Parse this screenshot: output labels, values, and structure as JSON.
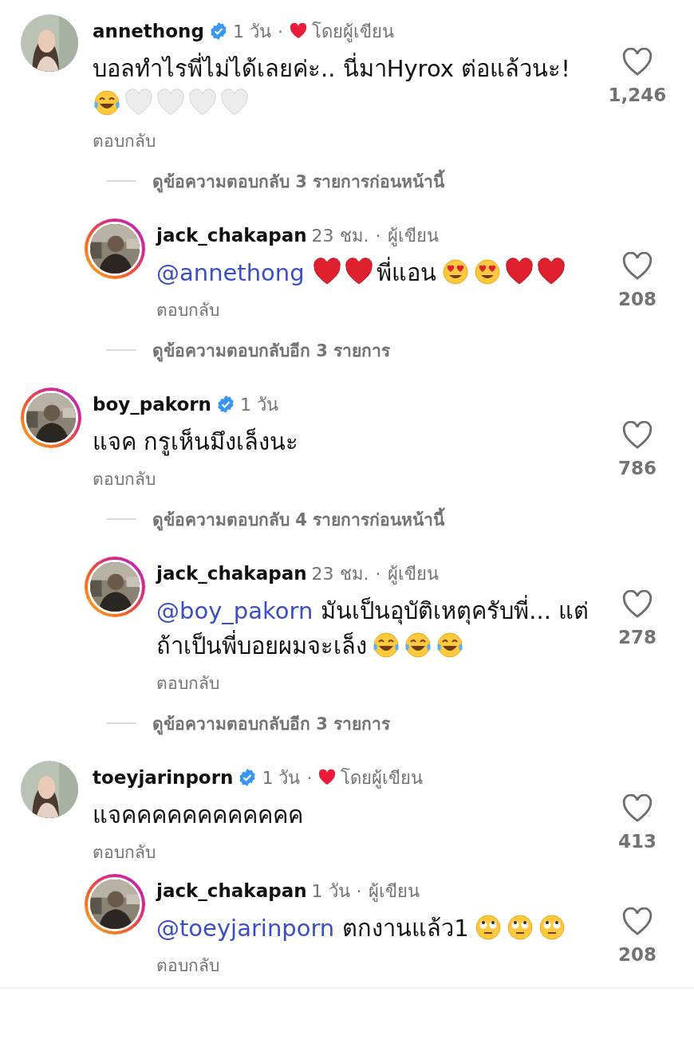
{
  "comments": [
    {
      "username": "annethong",
      "verified": true,
      "story_ring": false,
      "time": "1 วัน",
      "separator": "·",
      "liked_by_author": true,
      "author_note": "โดยผู้เขียน",
      "liked": false,
      "likes": "1,246",
      "reply_label": "ตอบกลับ",
      "view_replies": "ดูข้อความตอบกลับ 3 รายการก่อนหน้านี้",
      "text": [
        {
          "kind": "text",
          "text": "บอลทำไรพี่ไม่ได้เลยค่ะ.. นี่มาHyrox ต่อแล้วนะ!"
        },
        {
          "kind": "break"
        },
        {
          "kind": "joy"
        },
        {
          "kind": "white_heart"
        },
        {
          "kind": "white_heart"
        },
        {
          "kind": "white_heart"
        },
        {
          "kind": "white_heart"
        }
      ],
      "replies": [
        {
          "username": "jack_chakapan",
          "verified": false,
          "story_ring": true,
          "time": "23 ชม.",
          "separator": "·",
          "liked_by_author": false,
          "author_note": "ผู้เขียน",
          "liked": false,
          "likes": "208",
          "reply_label": "ตอบกลับ",
          "view_replies": "ดูข้อความตอบกลับอีก 3 รายการ",
          "text": [
            {
              "kind": "mention",
              "text": "@annethong"
            },
            {
              "kind": "red_heart"
            },
            {
              "kind": "red_heart"
            },
            {
              "kind": "text",
              "text": "พี่แอน"
            },
            {
              "kind": "heart_eyes"
            },
            {
              "kind": "heart_eyes"
            },
            {
              "kind": "red_heart"
            },
            {
              "kind": "red_heart"
            }
          ]
        }
      ]
    },
    {
      "username": "boy_pakorn",
      "verified": true,
      "story_ring": true,
      "time": "1 วัน",
      "liked_by_author": false,
      "liked": false,
      "likes": "786",
      "reply_label": "ตอบกลับ",
      "view_replies": "ดูข้อความตอบกลับ 4 รายการก่อนหน้านี้",
      "text": [
        {
          "kind": "text",
          "text": "แจค กรูเห็นมึงเล็งนะ"
        }
      ],
      "replies": [
        {
          "username": "jack_chakapan",
          "verified": false,
          "story_ring": true,
          "time": "23 ชม.",
          "separator": "·",
          "liked_by_author": false,
          "author_note": "ผู้เขียน",
          "liked": false,
          "likes": "278",
          "reply_label": "ตอบกลับ",
          "view_replies": "ดูข้อความตอบกลับอีก 3 รายการ",
          "text": [
            {
              "kind": "mention",
              "text": "@boy_pakorn"
            },
            {
              "kind": "text",
              "text": "มันเป็นอุบัติเหตุครับพี่... แต่"
            },
            {
              "kind": "break"
            },
            {
              "kind": "text",
              "text": "ถ้าเป็นพี่บอยผมจะเล็ง"
            },
            {
              "kind": "joy"
            },
            {
              "kind": "joy"
            },
            {
              "kind": "joy"
            }
          ]
        }
      ]
    },
    {
      "username": "toeyjarinporn",
      "verified": true,
      "story_ring": false,
      "time": "1 วัน",
      "separator": "·",
      "liked_by_author": true,
      "author_note": "โดยผู้เขียน",
      "liked": false,
      "likes": "413",
      "reply_label": "ตอบกลับ",
      "text": [
        {
          "kind": "text",
          "text": "แจคคคคคคคคคคคค"
        }
      ],
      "replies": [
        {
          "username": "jack_chakapan",
          "verified": false,
          "story_ring": true,
          "time": "1 วัน",
          "separator": "·",
          "liked_by_author": false,
          "author_note": "ผู้เขียน",
          "liked": false,
          "likes": "208",
          "reply_label": "ตอบกลับ",
          "text": [
            {
              "kind": "mention",
              "text": "@toeyjarinporn"
            },
            {
              "kind": "text",
              "text": "ตกงานแล้ว1"
            },
            {
              "kind": "eye_roll"
            },
            {
              "kind": "eye_roll"
            },
            {
              "kind": "eye_roll"
            }
          ]
        }
      ]
    }
  ]
}
